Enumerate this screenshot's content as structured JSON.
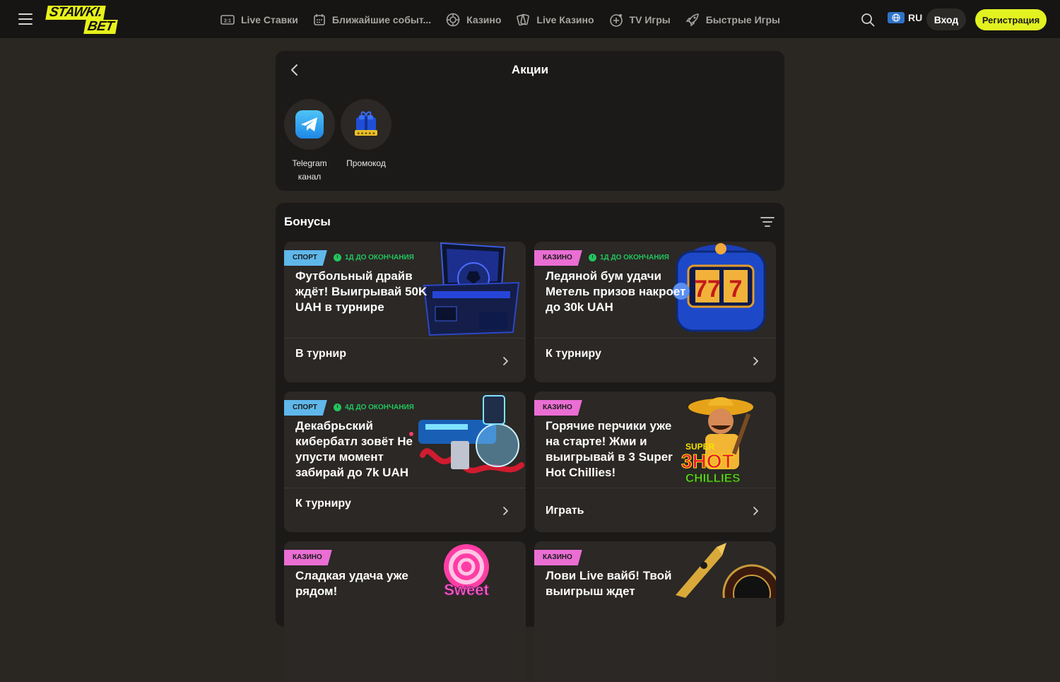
{
  "header": {
    "logo_line1": "STAWKI.",
    "logo_line2": "BET",
    "nav": [
      {
        "label": "Live Ставки",
        "icon": "live-bets-icon"
      },
      {
        "label": "Ближайшие событ...",
        "icon": "calendar-icon"
      },
      {
        "label": "Казино",
        "icon": "casino-chip-icon"
      },
      {
        "label": "Live Казино",
        "icon": "cards-icon"
      },
      {
        "label": "TV Игры",
        "icon": "tv-games-icon"
      },
      {
        "label": "Быстрые Игры",
        "icon": "rocket-icon"
      }
    ],
    "lang": "RU",
    "login": "Вход",
    "register": "Регистрация"
  },
  "promo": {
    "title": "Акции",
    "stories": [
      {
        "label": "Telegram канал",
        "icon": "telegram-icon"
      },
      {
        "label": "Промокод",
        "icon": "promo-gift-icon"
      }
    ]
  },
  "bonuses": {
    "title": "Бонусы",
    "cards": [
      {
        "tag": "СПОРТ",
        "timer": "1Д ДО ОКОНЧАНИЯ",
        "heading": "Футбольный драйв ждёт! Выигрывай 50K UAH в турнире",
        "cta": "В турнир",
        "art": "football-chest-image"
      },
      {
        "tag": "КАЗИНО",
        "timer": "1Д ДО ОКОНЧАНИЯ",
        "heading": "Ледяной бум удачи Метель призов накроет до 30k UAH",
        "cta": "К турниру",
        "art": "slot-machine-image"
      },
      {
        "tag": "СПОРТ",
        "timer": "4Д ДО ОКОНЧАНИЯ",
        "heading": "Декабрьский кибербатл зовёт Не упусти момент забирай до 7k UAH",
        "cta": "К турниру",
        "art": "cyber-gun-image"
      },
      {
        "tag": "КАЗИНО",
        "timer": "",
        "heading": "Горячие перчики уже на старте! Жми и выигрывай в 3 Super Hot Chillies!",
        "cta": "Играть",
        "art": "hot-chillies-image"
      },
      {
        "tag": "КАЗИНО",
        "timer": "",
        "heading": "Сладкая удача уже рядом!",
        "cta": "",
        "art": "sweet-candy-image"
      },
      {
        "tag": "КАЗИНО",
        "timer": "",
        "heading": "Лови Live вайб! Твой выигрыш ждет",
        "cta": "",
        "art": "roulette-rocket-image"
      }
    ],
    "art_text": {
      "sweet": "Sweet",
      "super": "SUPER",
      "hot": "3HOT",
      "chillies": "CHILLIES",
      "slot": "77"
    }
  },
  "colors": {
    "accent": "#e2f220",
    "sport_tag": "#5fb7ea",
    "casino_tag": "#ea6ed3",
    "timer": "#22c55e",
    "bg": "#2a2622",
    "panel": "#1c1a18",
    "card": "#2b2825"
  }
}
